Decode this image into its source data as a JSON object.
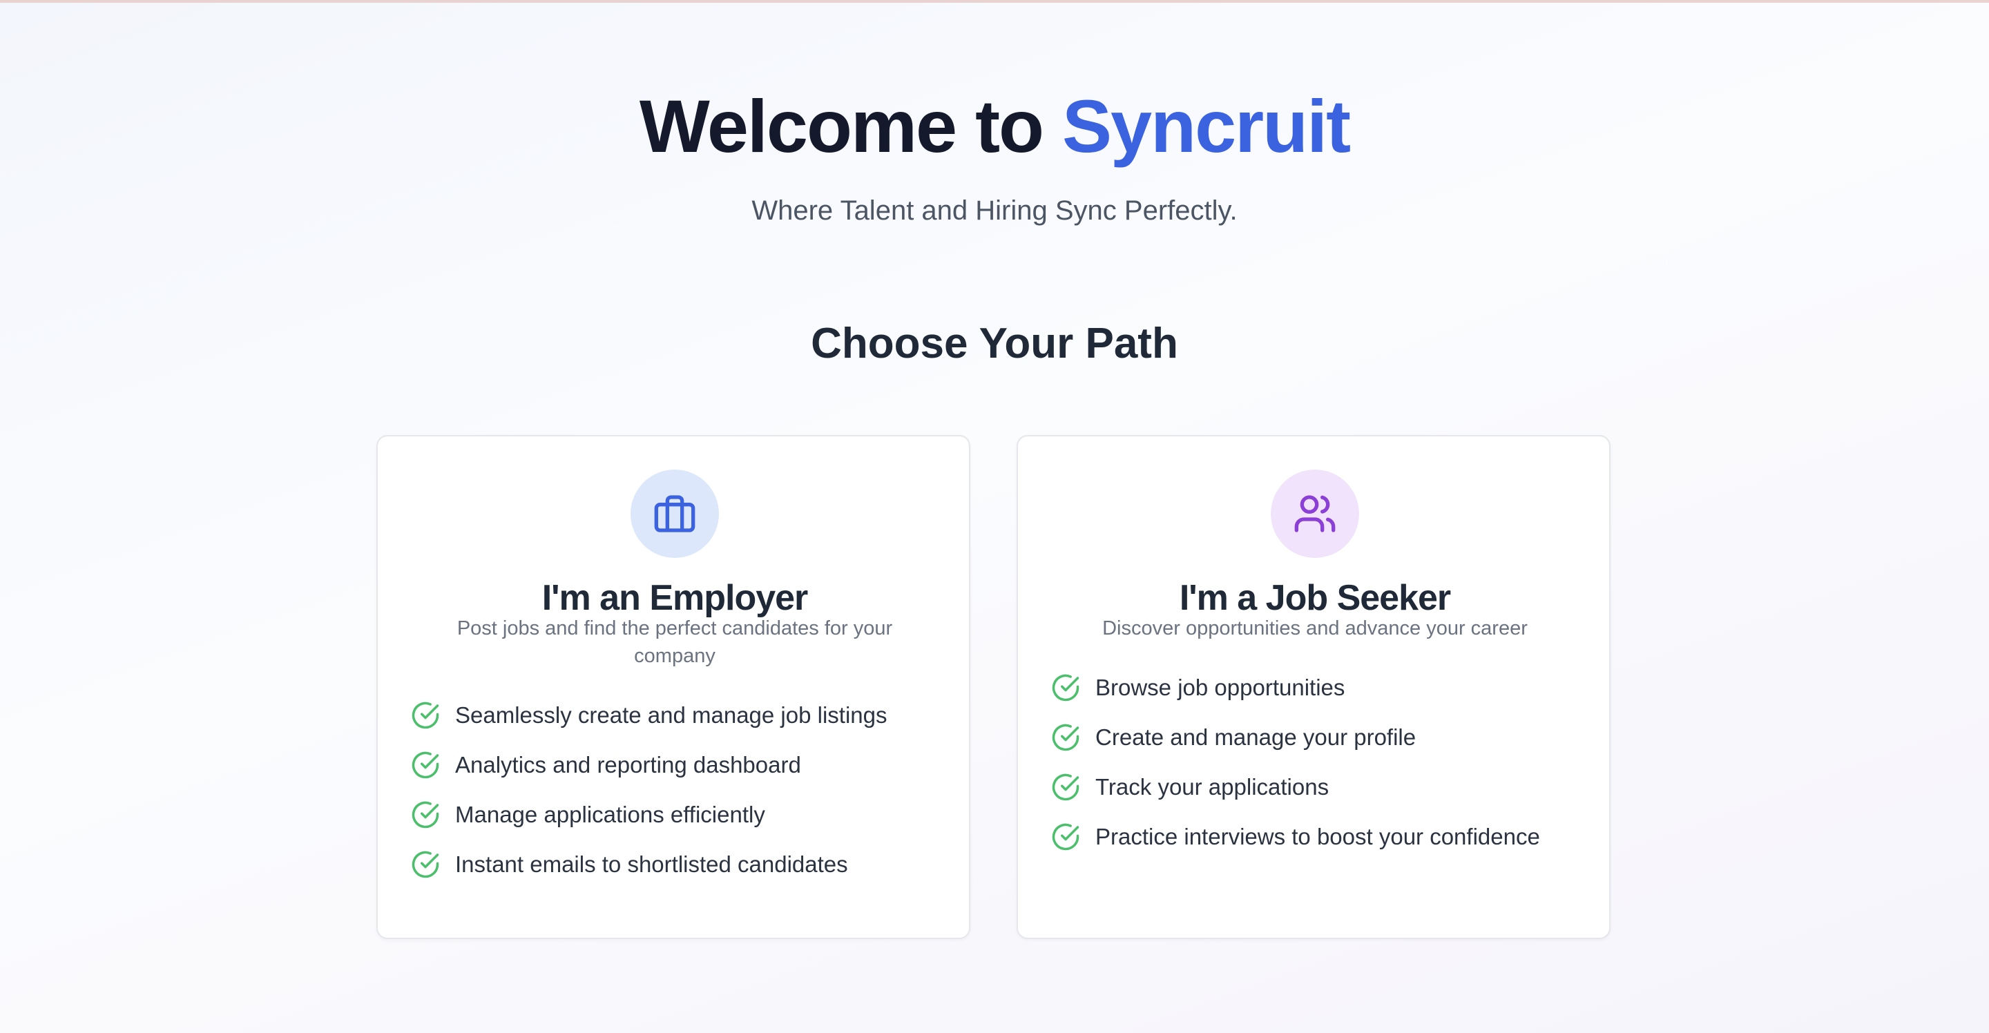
{
  "header": {
    "title_prefix": "Welcome to",
    "title_brand": "Syncruit",
    "tagline": "Where Talent and Hiring Sync Perfectly."
  },
  "section": {
    "title": "Choose Your Path"
  },
  "colors": {
    "brand": "#3b63e0",
    "check": "#4bbf6b",
    "employer_icon": "#3b63e0",
    "employer_icon_bg": "#dde7fb",
    "seeker_icon": "#8b3fd6",
    "seeker_icon_bg": "#f1e3fb"
  },
  "cards": {
    "employer": {
      "icon": "briefcase-icon",
      "title": "I'm an Employer",
      "description": "Post jobs and find the perfect candidates for your company",
      "features": [
        "Seamlessly create and manage job listings",
        "Analytics and reporting dashboard",
        "Manage applications efficiently",
        "Instant emails to shortlisted candidates"
      ]
    },
    "seeker": {
      "icon": "users-icon",
      "title": "I'm a Job Seeker",
      "description": "Discover opportunities and advance your career",
      "features": [
        "Browse job opportunities",
        "Create and manage your profile",
        "Track your applications",
        "Practice interviews to boost your confidence"
      ]
    }
  }
}
